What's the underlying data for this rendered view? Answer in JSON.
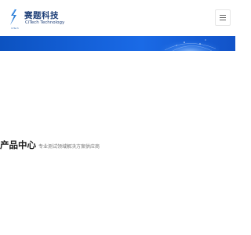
{
  "header": {
    "brand_cn": "赛题科技",
    "brand_en": "CiTech Technology",
    "logo_sub": "CiTech",
    "logo_icon": "lightning-s-logo-icon",
    "menu_icon": "hamburger-menu-icon"
  },
  "section": {
    "title": "产品中心",
    "subtitle": "专业测试领域解决方案供应商"
  },
  "colors": {
    "brand": "#1e3f78",
    "banner": "#1460d8",
    "accent": "#1a6ae6"
  }
}
